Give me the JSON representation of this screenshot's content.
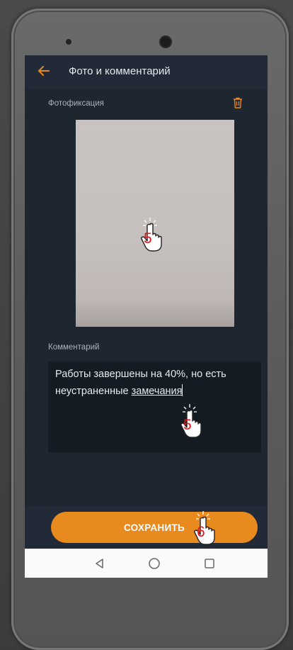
{
  "header": {
    "title": "Фото и комментарий"
  },
  "photo": {
    "label": "Фотофиксация"
  },
  "comment": {
    "label": "Комментарий",
    "text_before": "Работы завершены на 40%, но есть неустраненные ",
    "text_underlined": "замечания"
  },
  "actions": {
    "save_label": "СОХРАНИТЬ"
  },
  "steps": {
    "photo_step": "5",
    "comment_step": "5",
    "save_step": "6"
  },
  "colors": {
    "accent": "#e88a1e",
    "background": "#1e2630",
    "header": "#212a36",
    "step_number": "#e3131b"
  },
  "icons": [
    "back-arrow-icon",
    "trash-icon",
    "nav-back-icon",
    "nav-home-icon",
    "nav-recents-icon",
    "pointer-hand-icon"
  ]
}
